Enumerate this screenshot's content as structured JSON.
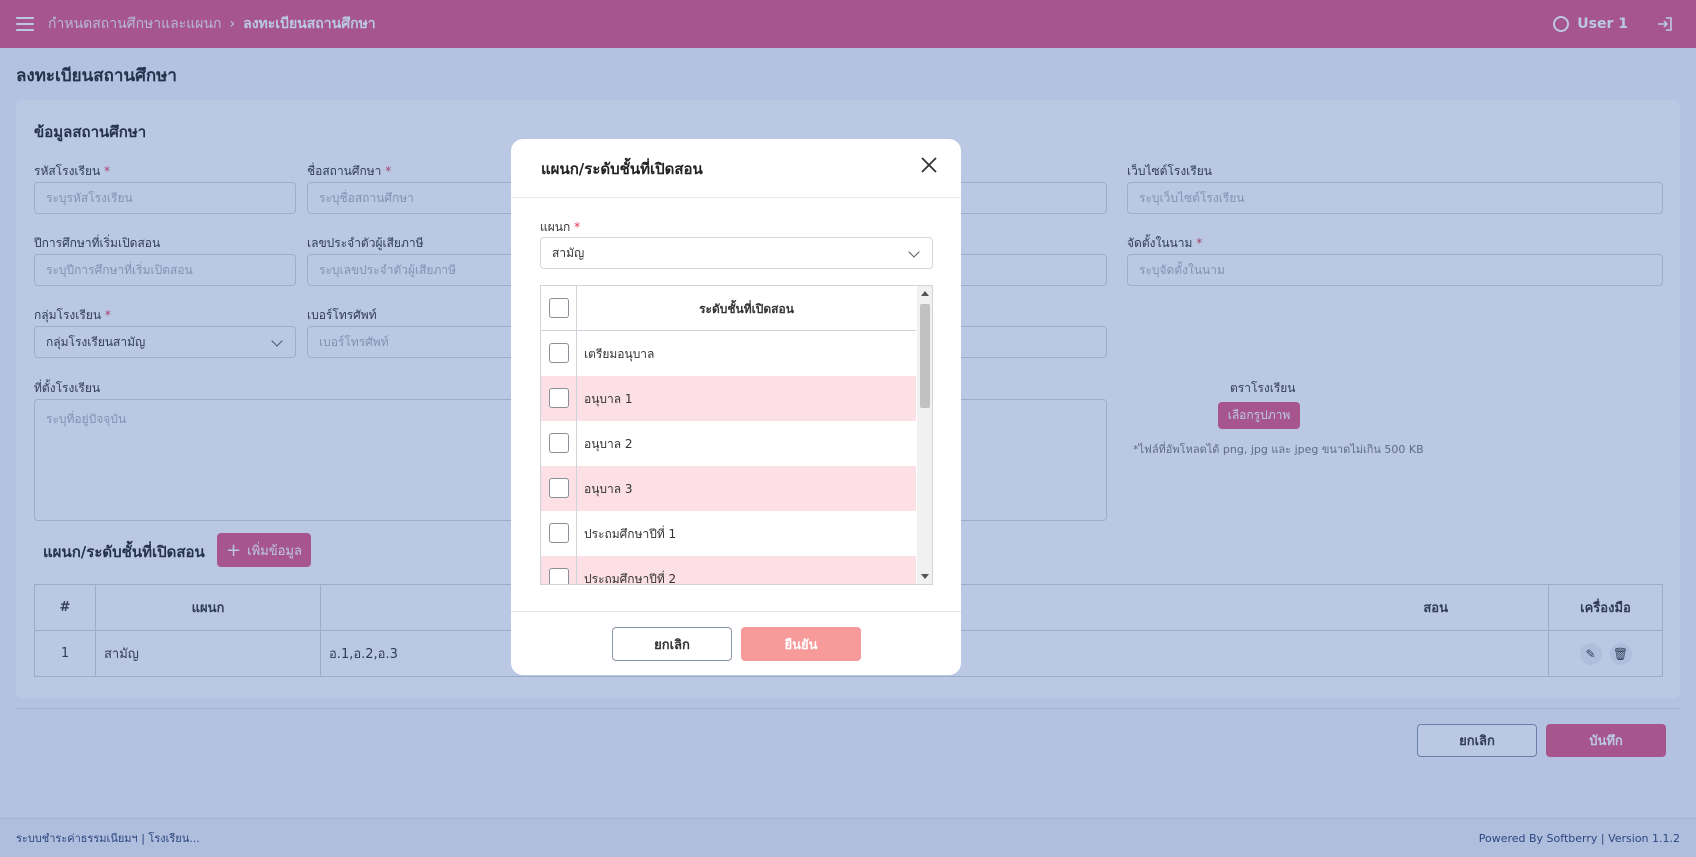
{
  "header": {
    "breadcrumb_parent": "กำหนดสถานศึกษาและแผนก",
    "breadcrumb_current": "ลงทะเบียนสถานศึกษา",
    "user_name": "User 1"
  },
  "page": {
    "title": "ลงทะเบียนสถานศึกษา"
  },
  "form": {
    "section_title": "ข้อมูลสถานศึกษา",
    "school_code": {
      "label": "รหัสโรงเรียน",
      "placeholder": "ระบุรหัสโรงเรียน"
    },
    "school_name": {
      "label": "ชื่อสถานศึกษา",
      "placeholder": "ระบุชื่อสถานศึกษา"
    },
    "website": {
      "label": "เว็บไซต์โรงเรียน",
      "placeholder": "ระบุเว็บไซต์โรงเรียน"
    },
    "start_year": {
      "label": "ปีการศึกษาที่เริ่มเปิดสอน",
      "placeholder": "ระบุปีการศึกษาที่เริ่มเปิดสอน"
    },
    "tax_id": {
      "label": "เลขประจำตัวผู้เสียภาษี",
      "placeholder": "ระบุเลขประจำตัวผู้เสียภาษี"
    },
    "registered_name": {
      "label": "จัดตั้งในนาม",
      "placeholder": "ระบุจัดตั้งในนาม"
    },
    "school_group": {
      "label": "กลุ่มโรงเรียน",
      "value": "กลุ่มโรงเรียนสามัญ"
    },
    "phone": {
      "label": "เบอร์โทรศัพท์",
      "placeholder": "เบอร์โทรศัพท์"
    },
    "address": {
      "label": "ที่ตั้งโรงเรียน",
      "placeholder": "ระบุที่อยู่ปัจจุบัน"
    },
    "logo": {
      "label": "ตราโรงเรียน",
      "button": "เลือกรูปภาพ",
      "note": "*ไฟล์ที่อัพโหลดได้ png, jpg และ jpeg ขนาดไม่เกิน 500 KB"
    }
  },
  "departments": {
    "title": "แผนก/ระดับชั้นที่เปิดสอน",
    "add_button": "เพิ่มข้อมูล",
    "columns": [
      "#",
      "แผนก",
      "สอน",
      "เครื่องมือ"
    ],
    "rows": [
      {
        "no": "1",
        "dept": "สามัญ",
        "levels": "อ.1,อ.2,อ.3"
      }
    ]
  },
  "actions": {
    "cancel": "ยกเลิก",
    "save": "บันทึก"
  },
  "footer": {
    "left": "ระบบชำระค่าธรรมเนียมฯ | โรงเรียน...",
    "right": "Powered By Softberry | Version 1.1.2"
  },
  "modal": {
    "title": "แผนก/ระดับชั้นที่เปิดสอน",
    "dept_label": "แผนก",
    "dept_value": "สามัญ",
    "table_header": "ระดับชั้นที่เปิดสอน",
    "levels": [
      "เตรียมอนุบาล",
      "อนุบาล 1",
      "อนุบาล 2",
      "อนุบาล 3",
      "ประถมศึกษาปีที่ 1",
      "ประถมศึกษาปีที่ 2"
    ],
    "cancel": "ยกเลิก",
    "confirm": "ยืนยัน"
  },
  "colors": {
    "brand": "#e0567f",
    "row_alt": "#fde0e5",
    "overlay": "#2a55aa"
  }
}
